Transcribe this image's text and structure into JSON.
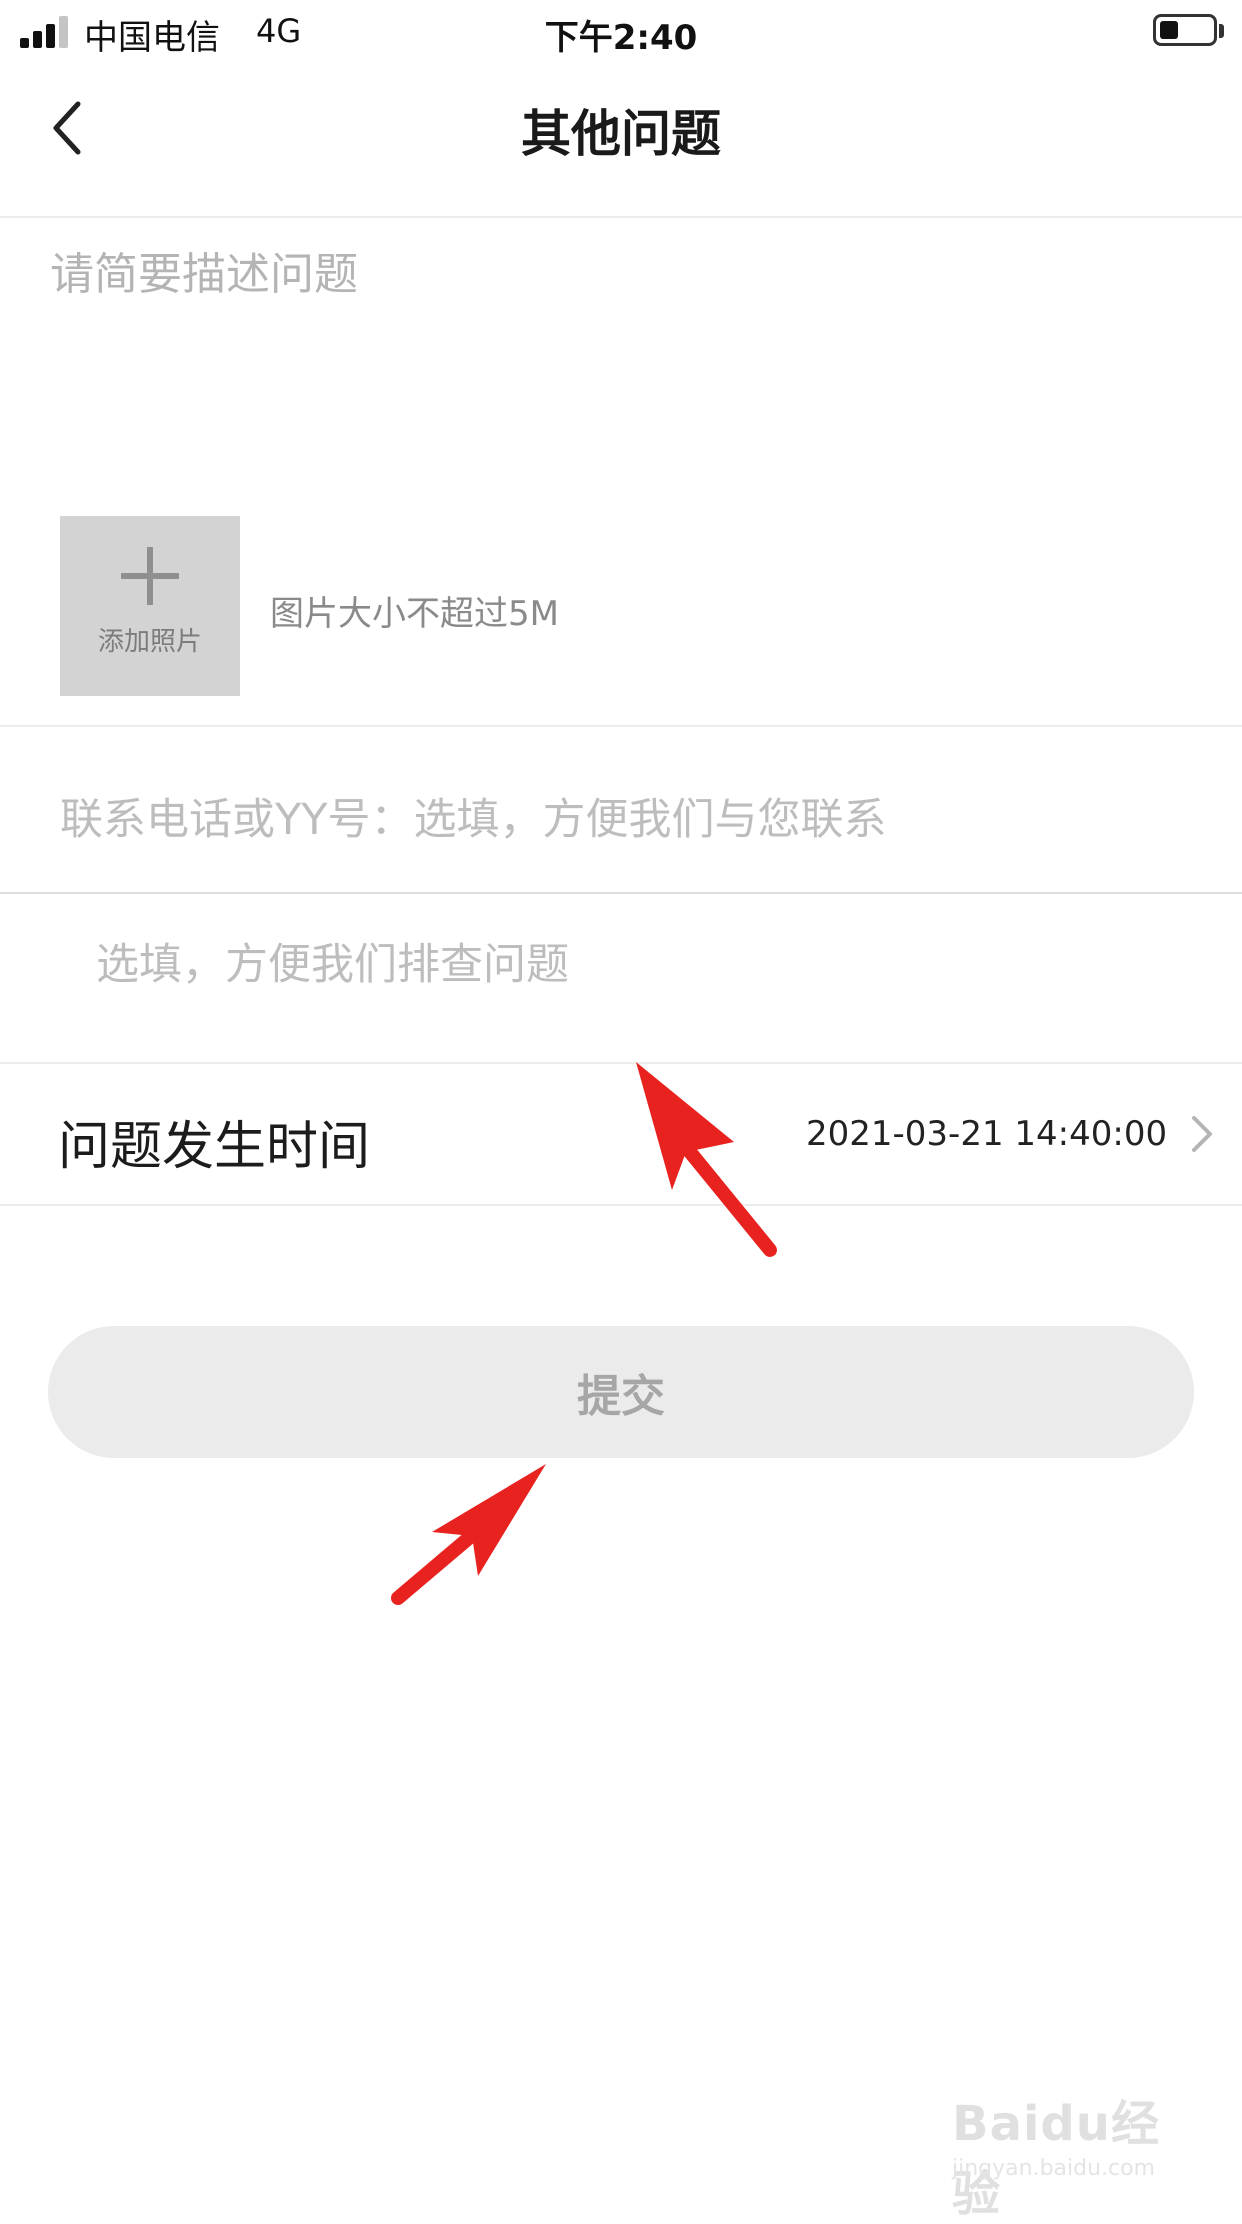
{
  "status_bar": {
    "carrier": "中国电信",
    "network": "4G",
    "time": "下午2:40",
    "signal_bars": 3,
    "battery_level": 0.35
  },
  "nav": {
    "back_icon": "chevron-left-icon",
    "title": "其他问题"
  },
  "form": {
    "description_placeholder": "请简要描述问题",
    "add_photo_label": "添加照片",
    "photo_hint": "图片大小不超过5M",
    "contact_placeholder": "联系电话或YY号：选填，方便我们与您联系",
    "extra_placeholder": "选填，方便我们排查问题",
    "time_label": "问题发生时间",
    "time_value": "2021-03-21 14:40:00",
    "submit_label": "提交"
  },
  "annotations": {
    "arrow_color": "#e8231f"
  },
  "watermark": {
    "logo": "Baidu经验",
    "url": "jingyan.baidu.com"
  }
}
